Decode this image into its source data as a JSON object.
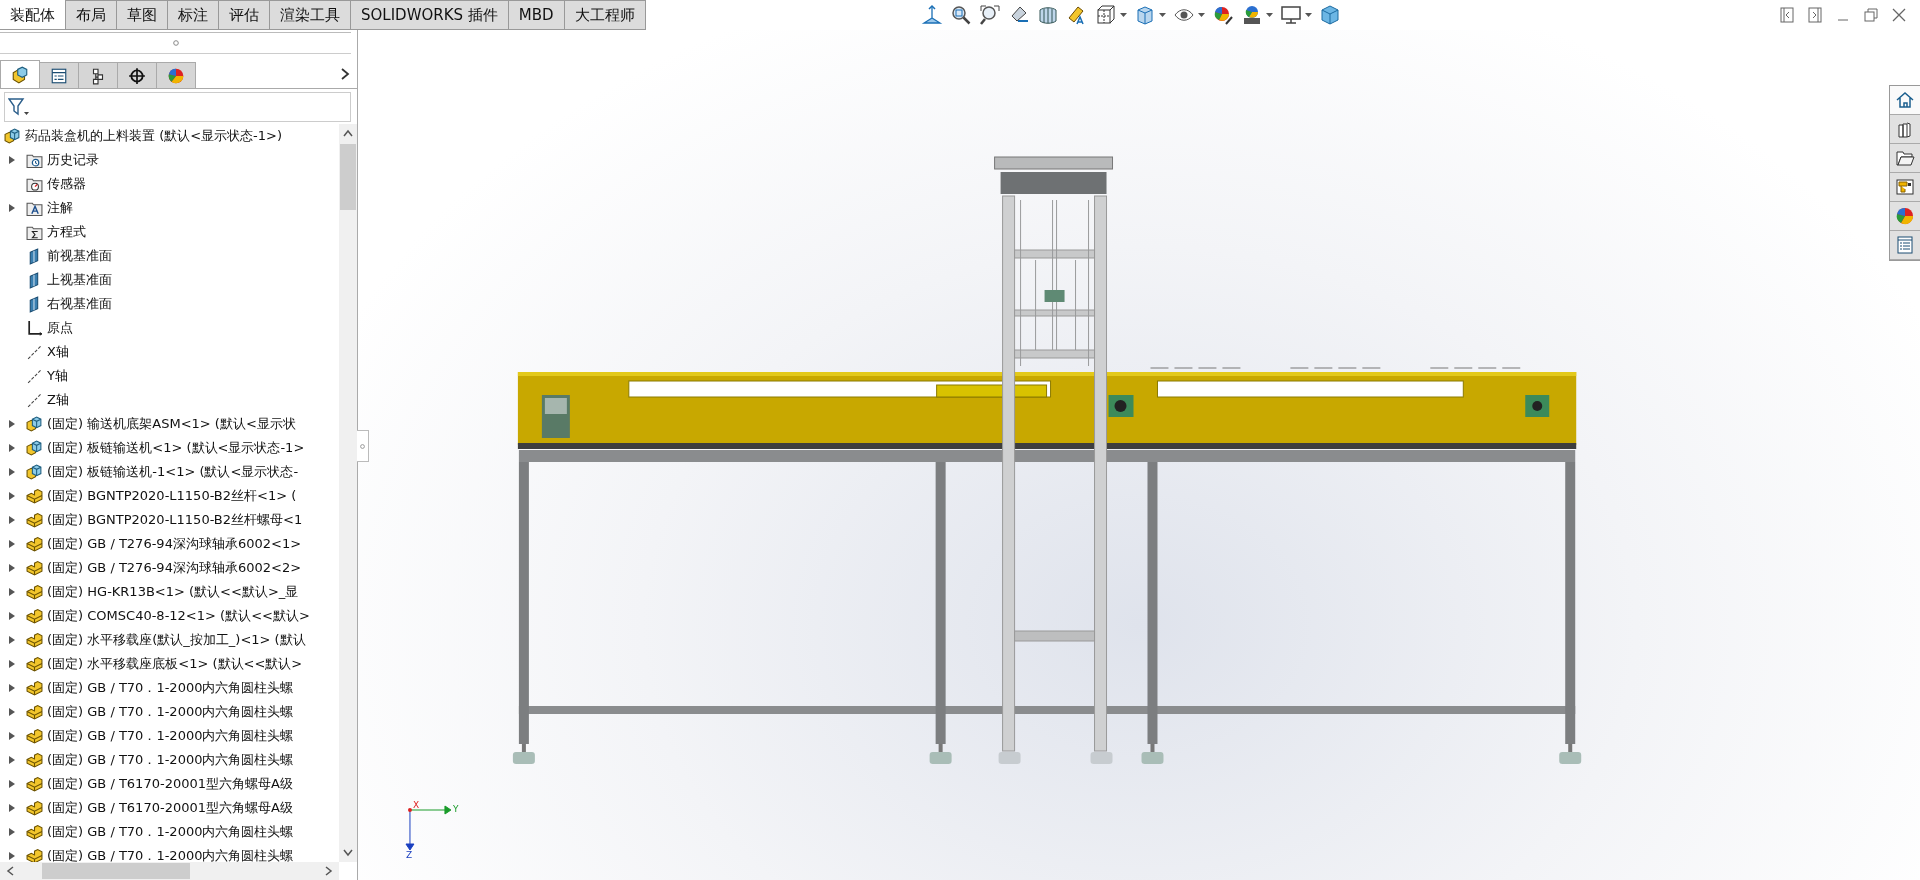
{
  "command_tabs": [
    {
      "label": "装配体",
      "selected": true
    },
    {
      "label": "布局",
      "selected": false
    },
    {
      "label": "草图",
      "selected": false
    },
    {
      "label": "标注",
      "selected": false
    },
    {
      "label": "评估",
      "selected": false
    },
    {
      "label": "渲染工具",
      "selected": false
    },
    {
      "label": "SOLIDWORKS 插件",
      "selected": false
    },
    {
      "label": "MBD",
      "selected": false
    },
    {
      "label": "大工程师",
      "selected": false
    }
  ],
  "panel_tabs": [
    {
      "kind": "tree",
      "selected": true
    },
    {
      "kind": "property",
      "selected": false
    },
    {
      "kind": "config",
      "selected": false
    },
    {
      "kind": "target",
      "selected": false
    },
    {
      "kind": "display",
      "selected": false
    }
  ],
  "tree": {
    "label": "药品装盒机的上料装置 (默认<显示状态-1>)",
    "kind": "assembly",
    "children": [
      {
        "label": "历史记录",
        "kind": "history",
        "expandable": true
      },
      {
        "label": "传感器",
        "kind": "sensor",
        "expandable": false
      },
      {
        "label": "注解",
        "kind": "annotation",
        "expandable": true
      },
      {
        "label": "方程式",
        "kind": "equation",
        "expandable": false
      },
      {
        "label": "前视基准面",
        "kind": "plane",
        "expandable": false
      },
      {
        "label": "上视基准面",
        "kind": "plane",
        "expandable": false
      },
      {
        "label": "右视基准面",
        "kind": "plane",
        "expandable": false
      },
      {
        "label": "原点",
        "kind": "origin",
        "expandable": false
      },
      {
        "label": "X轴",
        "kind": "axis",
        "expandable": false
      },
      {
        "label": "Y轴",
        "kind": "axis",
        "expandable": false
      },
      {
        "label": "Z轴",
        "kind": "axis",
        "expandable": false
      },
      {
        "label": "(固定) 输送机底架ASM<1> (默认<显示状",
        "kind": "assembly",
        "expandable": true
      },
      {
        "label": "(固定) 板链输送机<1> (默认<显示状态-1>",
        "kind": "assembly",
        "expandable": true
      },
      {
        "label": "(固定) 板链输送机-1<1> (默认<显示状态-",
        "kind": "assembly",
        "expandable": true
      },
      {
        "label": "(固定) BGNTP2020-L1150-B2丝杆<1> (",
        "kind": "part",
        "expandable": true
      },
      {
        "label": "(固定) BGNTP2020-L1150-B2丝杆螺母<1",
        "kind": "part",
        "expandable": true
      },
      {
        "label": "(固定) GB / T276-94深沟球轴承6002<1>",
        "kind": "part",
        "expandable": true
      },
      {
        "label": "(固定) GB / T276-94深沟球轴承6002<2>",
        "kind": "part",
        "expandable": true
      },
      {
        "label": "(固定) HG-KR13B<1> (默认<<默认>_显",
        "kind": "part",
        "expandable": true
      },
      {
        "label": "(固定) COMSC40-8-12<1> (默认<<默认>",
        "kind": "part",
        "expandable": true
      },
      {
        "label": "(固定) 水平移载座(默认_按加工_)<1> (默认",
        "kind": "part",
        "expandable": true
      },
      {
        "label": "(固定) 水平移载座底板<1> (默认<<默认>",
        "kind": "part",
        "expandable": true
      },
      {
        "label": "(固定) GB / T70．1-2000内六角圆柱头螺",
        "kind": "part",
        "expandable": true
      },
      {
        "label": "(固定) GB / T70．1-2000内六角圆柱头螺",
        "kind": "part",
        "expandable": true
      },
      {
        "label": "(固定) GB / T70．1-2000内六角圆柱头螺",
        "kind": "part",
        "expandable": true
      },
      {
        "label": "(固定) GB / T70．1-2000内六角圆柱头螺",
        "kind": "part",
        "expandable": true
      },
      {
        "label": "(固定) GB / T6170-20001型六角螺母A级",
        "kind": "part",
        "expandable": true
      },
      {
        "label": "(固定) GB / T6170-20001型六角螺母A级",
        "kind": "part",
        "expandable": true
      },
      {
        "label": "(固定) GB / T70．1-2000内六角圆柱头螺",
        "kind": "part",
        "expandable": true
      },
      {
        "label": "(固定) GB / T70．1-2000内六角圆柱头螺",
        "kind": "part",
        "expandable": true
      }
    ]
  },
  "triad": {
    "x": "X",
    "y": "Y",
    "z": "Z"
  }
}
